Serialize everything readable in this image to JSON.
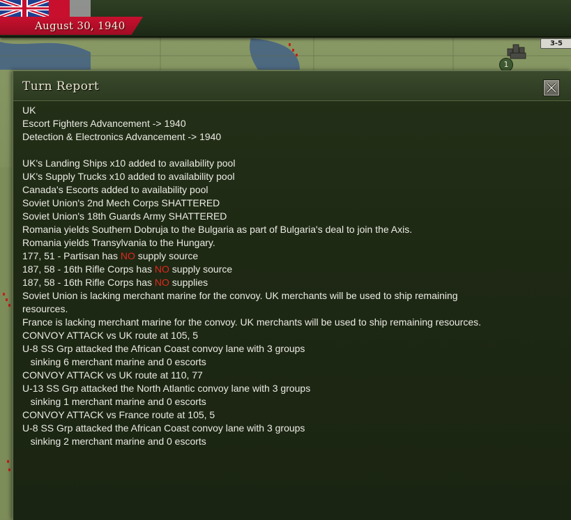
{
  "top_bar": {
    "date": "August 30, 1940",
    "flag_icon": "uk-flag-icon",
    "hex_badge": "3-5",
    "city_count": "1"
  },
  "dialog": {
    "title": "Turn Report",
    "close_icon": "close-x-icon",
    "lines": [
      {
        "segments": [
          {
            "text": "UK"
          }
        ]
      },
      {
        "segments": [
          {
            "text": "Escort Fighters Advancement -> 1940"
          }
        ]
      },
      {
        "segments": [
          {
            "text": "Detection & Electronics Advancement -> 1940"
          }
        ]
      },
      {
        "segments": [
          {
            "text": ""
          }
        ]
      },
      {
        "segments": [
          {
            "text": "UK's Landing Ships x10 added to availability pool"
          }
        ]
      },
      {
        "segments": [
          {
            "text": "UK's Supply Trucks x10 added to availability pool"
          }
        ]
      },
      {
        "segments": [
          {
            "text": "Canada's Escorts added to availability pool"
          }
        ]
      },
      {
        "segments": [
          {
            "text": "Soviet Union's 2nd Mech Corps SHATTERED"
          }
        ]
      },
      {
        "segments": [
          {
            "text": "Soviet Union's 18th Guards Army SHATTERED"
          }
        ]
      },
      {
        "segments": [
          {
            "text": "Romania yields Southern Dobruja to the Bulgaria as part of Bulgaria's deal to join the Axis."
          }
        ]
      },
      {
        "segments": [
          {
            "text": "Romania yields Transylvania to the Hungary."
          }
        ]
      },
      {
        "segments": [
          {
            "text": "177, 51 - Partisan has "
          },
          {
            "text": "NO",
            "highlight": true
          },
          {
            "text": " supply source"
          }
        ]
      },
      {
        "segments": [
          {
            "text": "187, 58 - 16th Rifle Corps has "
          },
          {
            "text": "NO",
            "highlight": true
          },
          {
            "text": " supply source"
          }
        ]
      },
      {
        "segments": [
          {
            "text": "187, 58 - 16th Rifle Corps has "
          },
          {
            "text": "NO",
            "highlight": true
          },
          {
            "text": " supplies"
          }
        ]
      },
      {
        "segments": [
          {
            "text": "Soviet Union is lacking merchant marine for the convoy. UK merchants will be used to ship remaining"
          }
        ]
      },
      {
        "segments": [
          {
            "text": "resources."
          }
        ]
      },
      {
        "segments": [
          {
            "text": "France is lacking merchant marine for the convoy. UK merchants will be used to ship remaining resources."
          }
        ]
      },
      {
        "segments": [
          {
            "text": "CONVOY ATTACK vs UK route at 105, 5"
          }
        ]
      },
      {
        "segments": [
          {
            "text": "U-8 SS Grp attacked the African Coast convoy lane with 3 groups"
          }
        ]
      },
      {
        "segments": [
          {
            "text": "   sinking 6 merchant marine and 0 escorts"
          }
        ]
      },
      {
        "segments": [
          {
            "text": "CONVOY ATTACK vs UK route at 110, 77"
          }
        ]
      },
      {
        "segments": [
          {
            "text": "U-13 SS Grp attacked the North Atlantic convoy lane with 3 groups"
          }
        ]
      },
      {
        "segments": [
          {
            "text": "   sinking 1 merchant marine and 0 escorts"
          }
        ]
      },
      {
        "segments": [
          {
            "text": "CONVOY ATTACK vs France route at 105, 5"
          }
        ]
      },
      {
        "segments": [
          {
            "text": "U-8 SS Grp attacked the African Coast convoy lane with 3 groups"
          }
        ]
      },
      {
        "segments": [
          {
            "text": "   sinking 2 merchant marine and 0 escorts"
          }
        ]
      }
    ]
  },
  "colors": {
    "negative_highlight": "#e0281e",
    "date_ribbon": "#c8102e",
    "dialog_background": "#1e2914",
    "text": "#ecebe4"
  }
}
